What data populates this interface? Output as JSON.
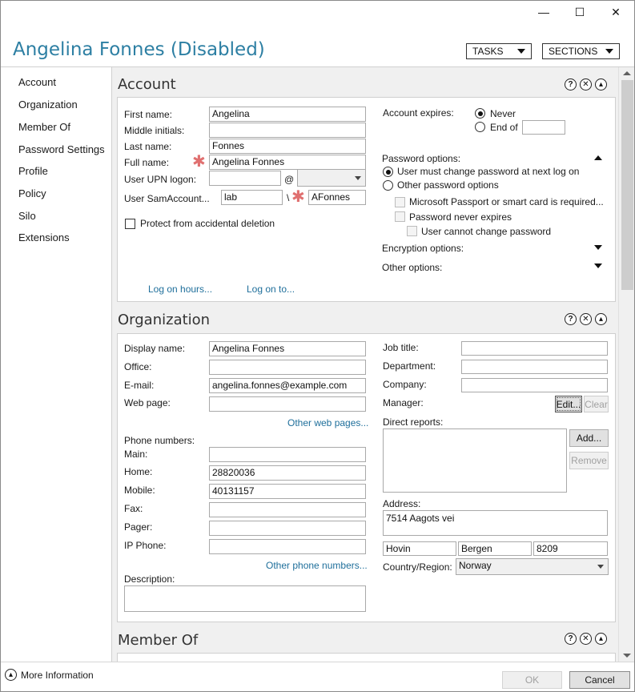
{
  "window": {
    "minimize": "—",
    "maximize": "☐",
    "close": "✕"
  },
  "header": {
    "title": "Angelina Fonnes (Disabled)",
    "tasks": "TASKS",
    "sections": "SECTIONS"
  },
  "sidebar": {
    "items": [
      {
        "label": "Account"
      },
      {
        "label": "Organization"
      },
      {
        "label": "Member Of"
      },
      {
        "label": "Password Settings"
      },
      {
        "label": "Profile"
      },
      {
        "label": "Policy"
      },
      {
        "label": "Silo"
      },
      {
        "label": "Extensions"
      }
    ]
  },
  "section_icons": {
    "help": "?",
    "close": "✕",
    "collapse": "▴"
  },
  "account": {
    "title": "Account",
    "first_name_label": "First name:",
    "first_name": "Angelina",
    "middle_label": "Middle initials:",
    "middle": "",
    "last_name_label": "Last name:",
    "last_name": "Fonnes",
    "full_name_label": "Full name:",
    "full_name": "Angelina Fonnes",
    "upn_label": "User UPN logon:",
    "upn": "",
    "at": "@",
    "upn_domain": "",
    "sam_label": "User SamAccount...",
    "sam_domain": "lab",
    "sam_sep": "\\",
    "sam_name": "AFonnes",
    "protect_label": "Protect from accidental deletion",
    "logon_hours": "Log on hours...",
    "logon_to": "Log on to...",
    "expires_label": "Account expires:",
    "never": "Never",
    "end_of": "End of",
    "end_of_value": "",
    "pwd_options": "Password options:",
    "must_change": "User must change password at next log on",
    "other_pwd": "Other password options",
    "passport": "Microsoft Passport or smart card is required...",
    "never_expires": "Password never expires",
    "cannot_change": "User cannot change password",
    "encryption": "Encryption options:",
    "other_options": "Other options:"
  },
  "organization": {
    "title": "Organization",
    "display_label": "Display name:",
    "display": "Angelina Fonnes",
    "office_label": "Office:",
    "office": "",
    "email_label": "E-mail:",
    "email": "angelina.fonnes@example.com",
    "web_label": "Web page:",
    "web": "",
    "other_web": "Other web pages...",
    "phone_label": "Phone numbers:",
    "main_label": "Main:",
    "main": "",
    "home_label": "Home:",
    "home": "28820036",
    "mobile_label": "Mobile:",
    "mobile": "40131157",
    "fax_label": "Fax:",
    "fax": "",
    "pager_label": "Pager:",
    "pager": "",
    "ip_label": "IP Phone:",
    "ip": "",
    "other_phone": "Other phone numbers...",
    "desc_label": "Description:",
    "description": "",
    "job_label": "Job title:",
    "job": "",
    "dept_label": "Department:",
    "dept": "",
    "company_label": "Company:",
    "company": "",
    "manager_label": "Manager:",
    "edit": "Edit...",
    "clear": "Clear",
    "direct_label": "Direct reports:",
    "add": "Add...",
    "remove": "Remove",
    "address_label": "Address:",
    "street": "7514 Aagots vei",
    "city": "Hovin",
    "state": "Bergen",
    "zip": "8209",
    "country_label": "Country/Region:",
    "country": "Norway"
  },
  "member_of": {
    "title": "Member Of"
  },
  "footer": {
    "more_info": "More Information",
    "ok": "OK",
    "cancel": "Cancel"
  }
}
